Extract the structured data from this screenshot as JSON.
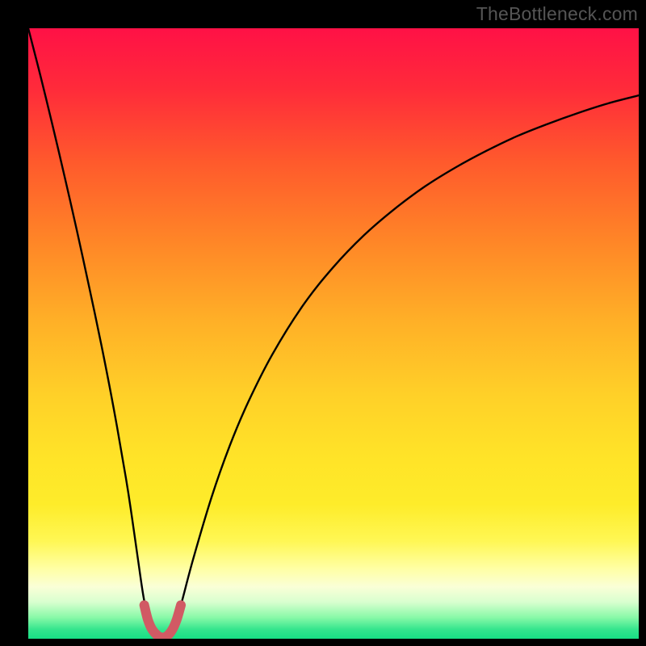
{
  "watermark": "TheBottleneck.com",
  "gradient": {
    "stops": [
      {
        "offset": 0.0,
        "color": "#ff1146"
      },
      {
        "offset": 0.1,
        "color": "#ff2b3a"
      },
      {
        "offset": 0.22,
        "color": "#ff5a2c"
      },
      {
        "offset": 0.35,
        "color": "#ff8627"
      },
      {
        "offset": 0.48,
        "color": "#ffb027"
      },
      {
        "offset": 0.6,
        "color": "#ffd028"
      },
      {
        "offset": 0.7,
        "color": "#ffe328"
      },
      {
        "offset": 0.78,
        "color": "#feec2a"
      },
      {
        "offset": 0.84,
        "color": "#fff754"
      },
      {
        "offset": 0.885,
        "color": "#ffffa4"
      },
      {
        "offset": 0.915,
        "color": "#faffd7"
      },
      {
        "offset": 0.94,
        "color": "#d8ffcf"
      },
      {
        "offset": 0.965,
        "color": "#89f9a8"
      },
      {
        "offset": 0.985,
        "color": "#34e58d"
      },
      {
        "offset": 1.0,
        "color": "#17df85"
      }
    ]
  },
  "chart_data": {
    "type": "line",
    "title": "",
    "xlabel": "",
    "ylabel": "",
    "x_range": [
      0,
      100
    ],
    "y_range": [
      0,
      100
    ],
    "series": [
      {
        "name": "bottleneck-curve",
        "x": [
          0,
          2,
          4,
          6,
          8,
          10,
          12,
          14,
          16,
          17,
          18,
          19,
          20,
          21,
          22,
          23,
          24,
          25,
          27,
          30,
          33,
          36,
          40,
          45,
          50,
          55,
          60,
          65,
          70,
          75,
          80,
          85,
          90,
          95,
          100
        ],
        "y": [
          100,
          92.2,
          84,
          75.5,
          66.7,
          57.5,
          48,
          37.7,
          26.3,
          19.8,
          12.8,
          6.2,
          2.4,
          0.6,
          0.0,
          0.6,
          2.4,
          5.5,
          13.0,
          23.1,
          31.6,
          38.7,
          46.6,
          54.6,
          60.9,
          66.1,
          70.4,
          74.1,
          77.2,
          79.9,
          82.3,
          84.3,
          86.1,
          87.7,
          89.0
        ]
      },
      {
        "name": "optimal-marker",
        "x": [
          19.0,
          19.6,
          20.3,
          21.2,
          22.0,
          22.8,
          23.6,
          24.3,
          25.0
        ],
        "y": [
          5.5,
          3.1,
          1.5,
          0.5,
          0.2,
          0.5,
          1.5,
          3.1,
          5.5
        ]
      }
    ],
    "optimal_x": 22,
    "marker_color": "#d15a64"
  }
}
